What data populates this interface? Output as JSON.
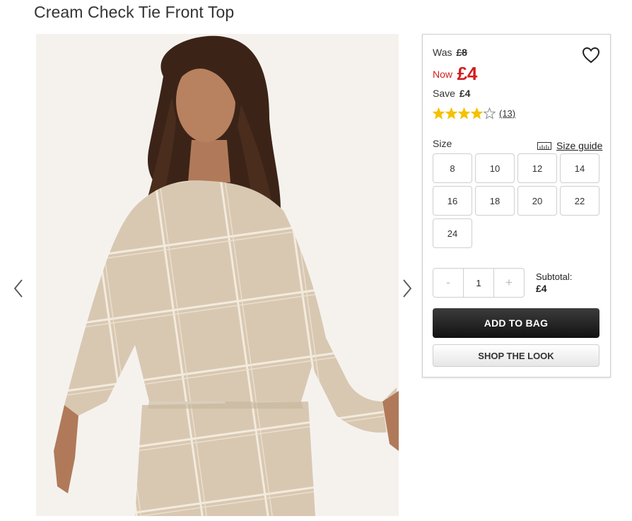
{
  "product": {
    "title": "Cream Check Tie Front Top",
    "image_alt": "Model wearing cream check tie front top"
  },
  "price": {
    "was_label": "Was",
    "was_value": "£8",
    "now_label": "Now",
    "now_value": "£4",
    "save_label": "Save",
    "save_value": "£4",
    "now_color": "#d21e1e"
  },
  "rating": {
    "stars": 4,
    "max_stars": 5,
    "reviews": "(13)",
    "star_color": "#f5c100"
  },
  "size": {
    "label": "Size",
    "guide_label": "Size guide",
    "options": [
      "8",
      "10",
      "12",
      "14",
      "16",
      "18",
      "20",
      "22",
      "24"
    ]
  },
  "quantity": {
    "minus": "-",
    "value": "1",
    "plus": "+"
  },
  "subtotal": {
    "label": "Subtotal:",
    "value": "£4"
  },
  "buttons": {
    "add_to_bag": "ADD TO BAG",
    "shop_the_look": "SHOP THE LOOK"
  }
}
